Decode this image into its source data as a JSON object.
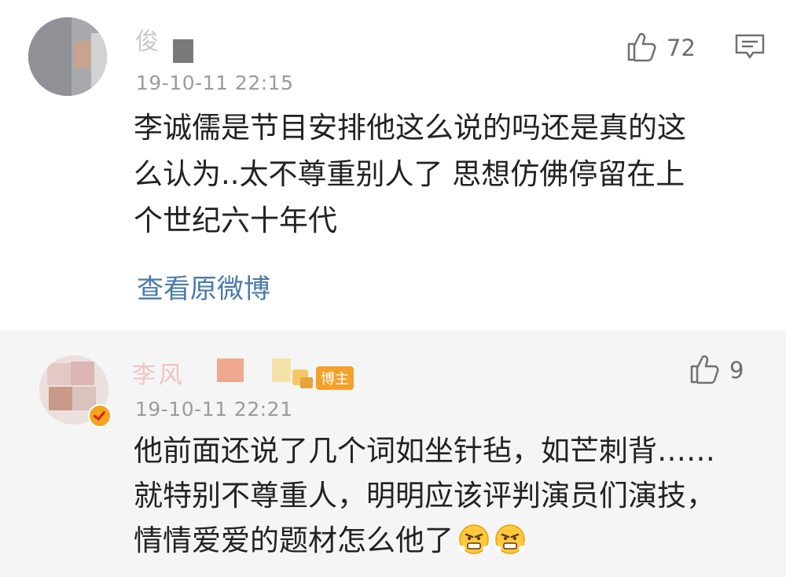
{
  "comments": [
    {
      "username": "俊",
      "timestamp": "19-10-11 22:15",
      "likes": "72",
      "body": "李诚儒是节目安排他这么说的吗还是真的这\n么认为..太不尊重别人了 思想仿佛停留在上\n个世纪六十年代",
      "view_original": "查看原微博"
    },
    {
      "username": "李风",
      "badge": "博主",
      "timestamp": "19-10-11 22:21",
      "likes": "9",
      "body": "他前面还说了几个词如坐针毡，如芒刺背……\n就特别不尊重人，明明应该评判演员们演技，\n情情爱爱的题材怎么他了"
    }
  ],
  "icons": {
    "like": "thumbs-up-icon",
    "reply": "comment-bubble-icon",
    "emoji": "angry-face-emoji",
    "verified": "verified-badge-icon"
  },
  "colors": {
    "link": "#4a7aa8",
    "badge": "#f3a12b",
    "secondary_bg": "#f5f5f5"
  }
}
